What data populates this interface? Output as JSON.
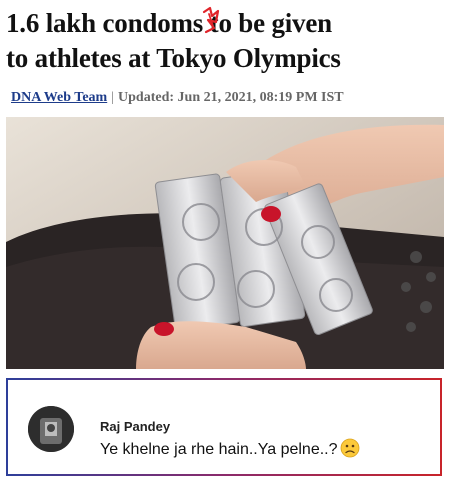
{
  "article": {
    "headline_line1": "1.6 lakh condoms to be given",
    "headline_line2": "to athletes at Tokyo Olympics",
    "author": "DNA Web Team",
    "separator": "|",
    "updated": "Updated: Jun 21, 2021, 08:19 PM IST"
  },
  "comment": {
    "author": "Raj Pandey",
    "text": "Ye khelne ja rhe hain..Ya pelne..?",
    "emoji": "worried-face-icon"
  },
  "colors": {
    "author_link": "#1d3c8a",
    "border_start": "#2e3f9a",
    "border_end": "#c8242a",
    "scribble": "#e0242a"
  }
}
